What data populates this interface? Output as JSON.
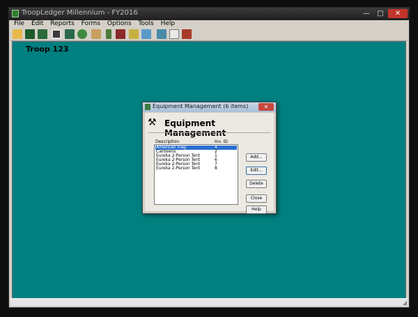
{
  "app": {
    "title": "TroopLedger Millennium - FY2016",
    "controls": {
      "minimize": "—",
      "maximize": "□",
      "close": "✕"
    }
  },
  "menu": [
    "File",
    "Edit",
    "Reports",
    "Forms",
    "Options",
    "Tools",
    "Help"
  ],
  "toolbar_icons": [
    "open-folder-icon",
    "save-icon",
    "print-icon",
    "ledger-icon",
    "calculator-icon",
    "money-bag-icon",
    "group-icon",
    "scout-icon",
    "person-icon",
    "equipment-icon",
    "handshake-icon",
    "notes-icon",
    "grid-icon",
    "help-icon"
  ],
  "client": {
    "troop_label": "Troop 123"
  },
  "dialog": {
    "title": "Equipment Management (6 items)",
    "close": "✕",
    "header": "Equipment Management",
    "columns": {
      "description": "Description",
      "inv_id": "Inv. ID"
    },
    "items": [
      {
        "description": "American Flag",
        "inv_id": "4",
        "selected": true
      },
      {
        "description": "Canteens",
        "inv_id": "2"
      },
      {
        "description": "Eureka 2-Person Tent",
        "inv_id": "1"
      },
      {
        "description": "Eureka 2-Person Tent",
        "inv_id": "6"
      },
      {
        "description": "Eureka 2-Person Tent",
        "inv_id": "7"
      },
      {
        "description": "Eureka 2-Person Tent",
        "inv_id": "8"
      }
    ],
    "buttons": {
      "add": "Add...",
      "edit": "Edit...",
      "delete": "Delete",
      "close": "Close",
      "help": "Help"
    }
  },
  "colors": {
    "client_bg": "#008080",
    "selection": "#2a6fd0",
    "titlebar": "#1f1f1f"
  }
}
